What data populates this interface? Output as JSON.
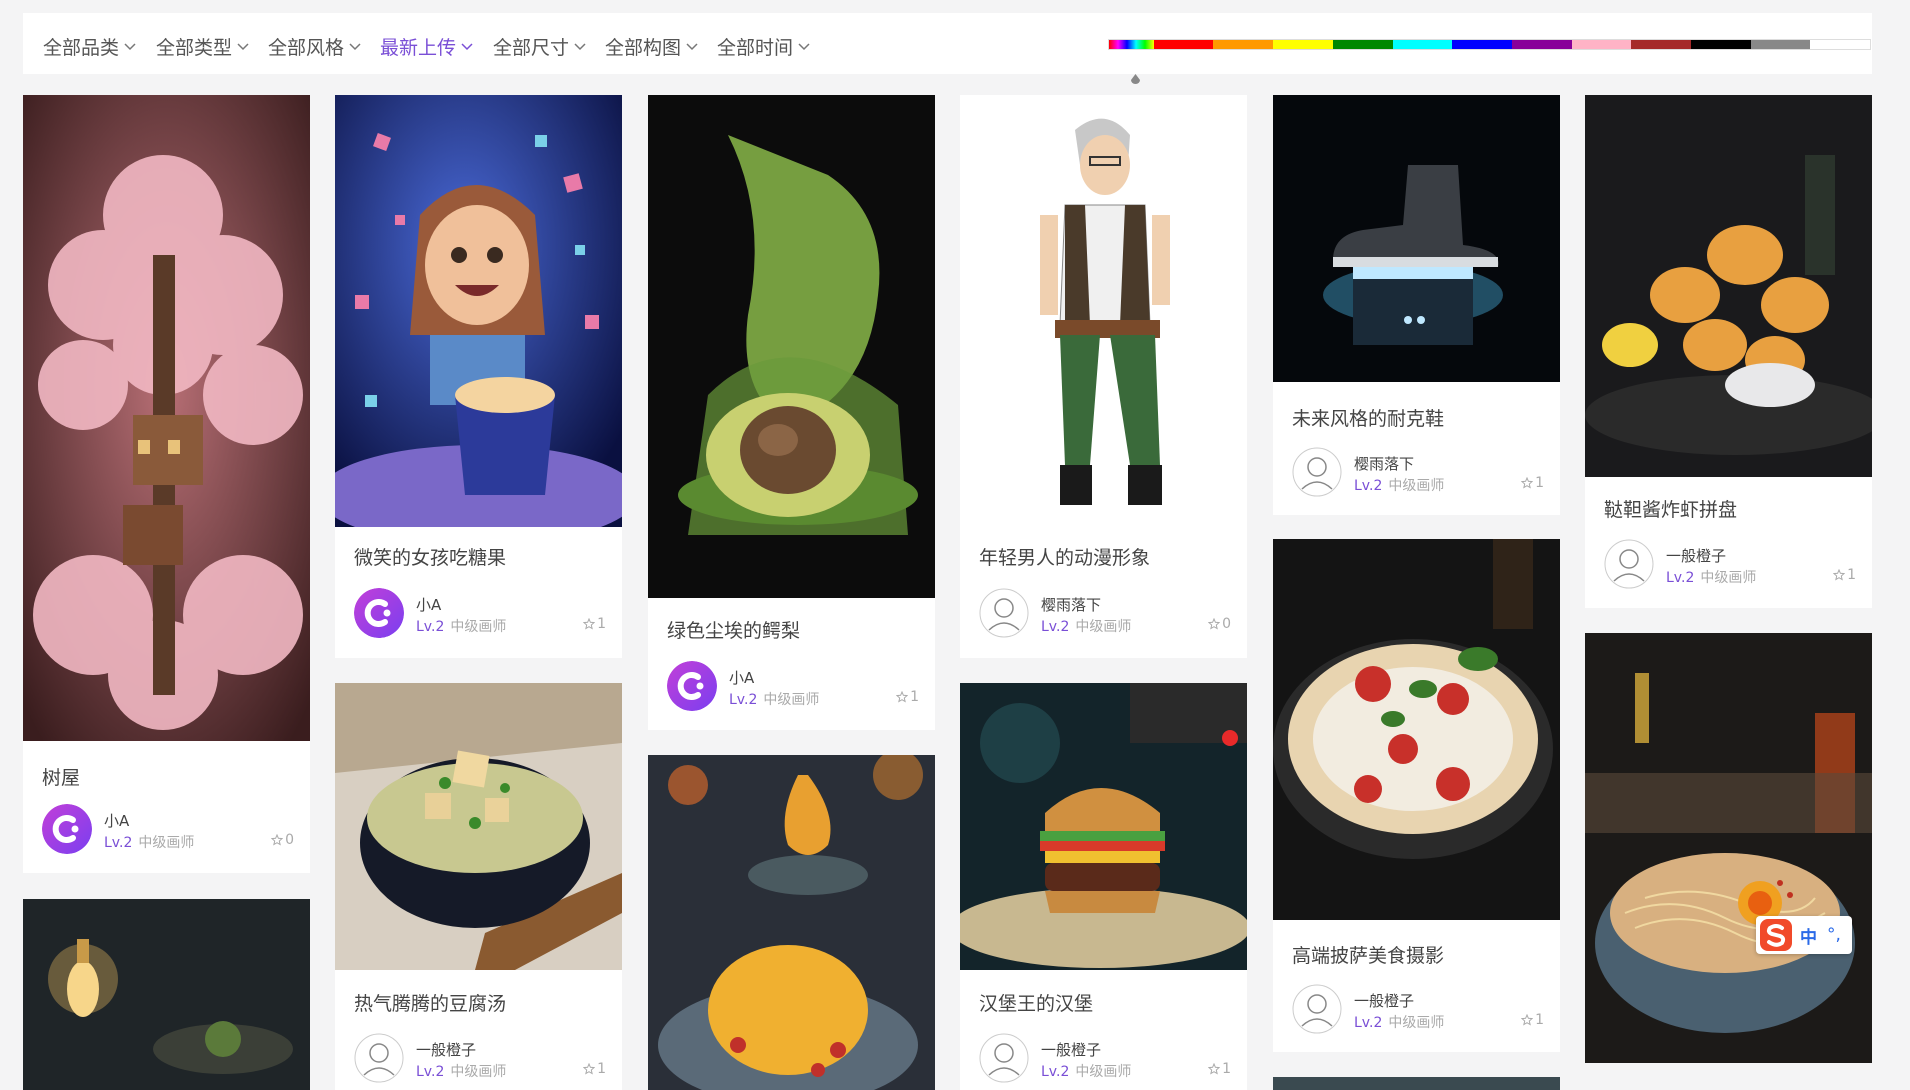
{
  "filters": [
    {
      "label": "全部品类",
      "active": false
    },
    {
      "label": "全部类型",
      "active": false
    },
    {
      "label": "全部风格",
      "active": false
    },
    {
      "label": "最新上传",
      "active": true
    },
    {
      "label": "全部尺寸",
      "active": false
    },
    {
      "label": "全部构图",
      "active": false
    },
    {
      "label": "全部时间",
      "active": false
    }
  ],
  "color_swatches": [
    "#ff0000",
    "#ff9900",
    "#ffff00",
    "#008800",
    "#00ffff",
    "#0000ff",
    "#880099",
    "#ffb3c6",
    "#a52a2a",
    "#000000",
    "#888888",
    "#ffffff"
  ],
  "accent_color": "#7a4fd6",
  "cards": [
    {
      "title": "树屋",
      "author": "小A",
      "level": "Lv.2",
      "rank": "中级画师",
      "likes": "0",
      "avatar": "logo-avatar"
    },
    {
      "title": "微笑的女孩吃糖果",
      "author": "小A",
      "level": "Lv.2",
      "rank": "中级画师",
      "likes": "1",
      "avatar": "logo-avatar"
    },
    {
      "title": "热气腾腾的豆腐汤",
      "author": "一般橙子",
      "level": "Lv.2",
      "rank": "中级画师",
      "likes": "1",
      "avatar": "user-avatar"
    },
    {
      "title": "绿色尘埃的鳄梨",
      "author": "小A",
      "level": "Lv.2",
      "rank": "中级画师",
      "likes": "1",
      "avatar": "logo-avatar"
    },
    {
      "title": "年轻男人的动漫形象",
      "author": "樱雨落下",
      "level": "Lv.2",
      "rank": "中级画师",
      "likes": "0",
      "avatar": "user-avatar"
    },
    {
      "title": "汉堡王的汉堡",
      "author": "一般橙子",
      "level": "Lv.2",
      "rank": "中级画师",
      "likes": "1",
      "avatar": "user-avatar"
    },
    {
      "title": "未来风格的耐克鞋",
      "author": "樱雨落下",
      "level": "Lv.2",
      "rank": "中级画师",
      "likes": "1",
      "avatar": "user-avatar"
    },
    {
      "title": "高端披萨美食摄影",
      "author": "一般橙子",
      "level": "Lv.2",
      "rank": "中级画师",
      "likes": "1",
      "avatar": "user-avatar"
    },
    {
      "title": "鞑靼酱炸虾拼盘",
      "author": "一般橙子",
      "level": "Lv.2",
      "rank": "中级画师",
      "likes": "1",
      "avatar": "user-avatar"
    }
  ],
  "ime": {
    "mode": "中",
    "punct": "°,"
  }
}
